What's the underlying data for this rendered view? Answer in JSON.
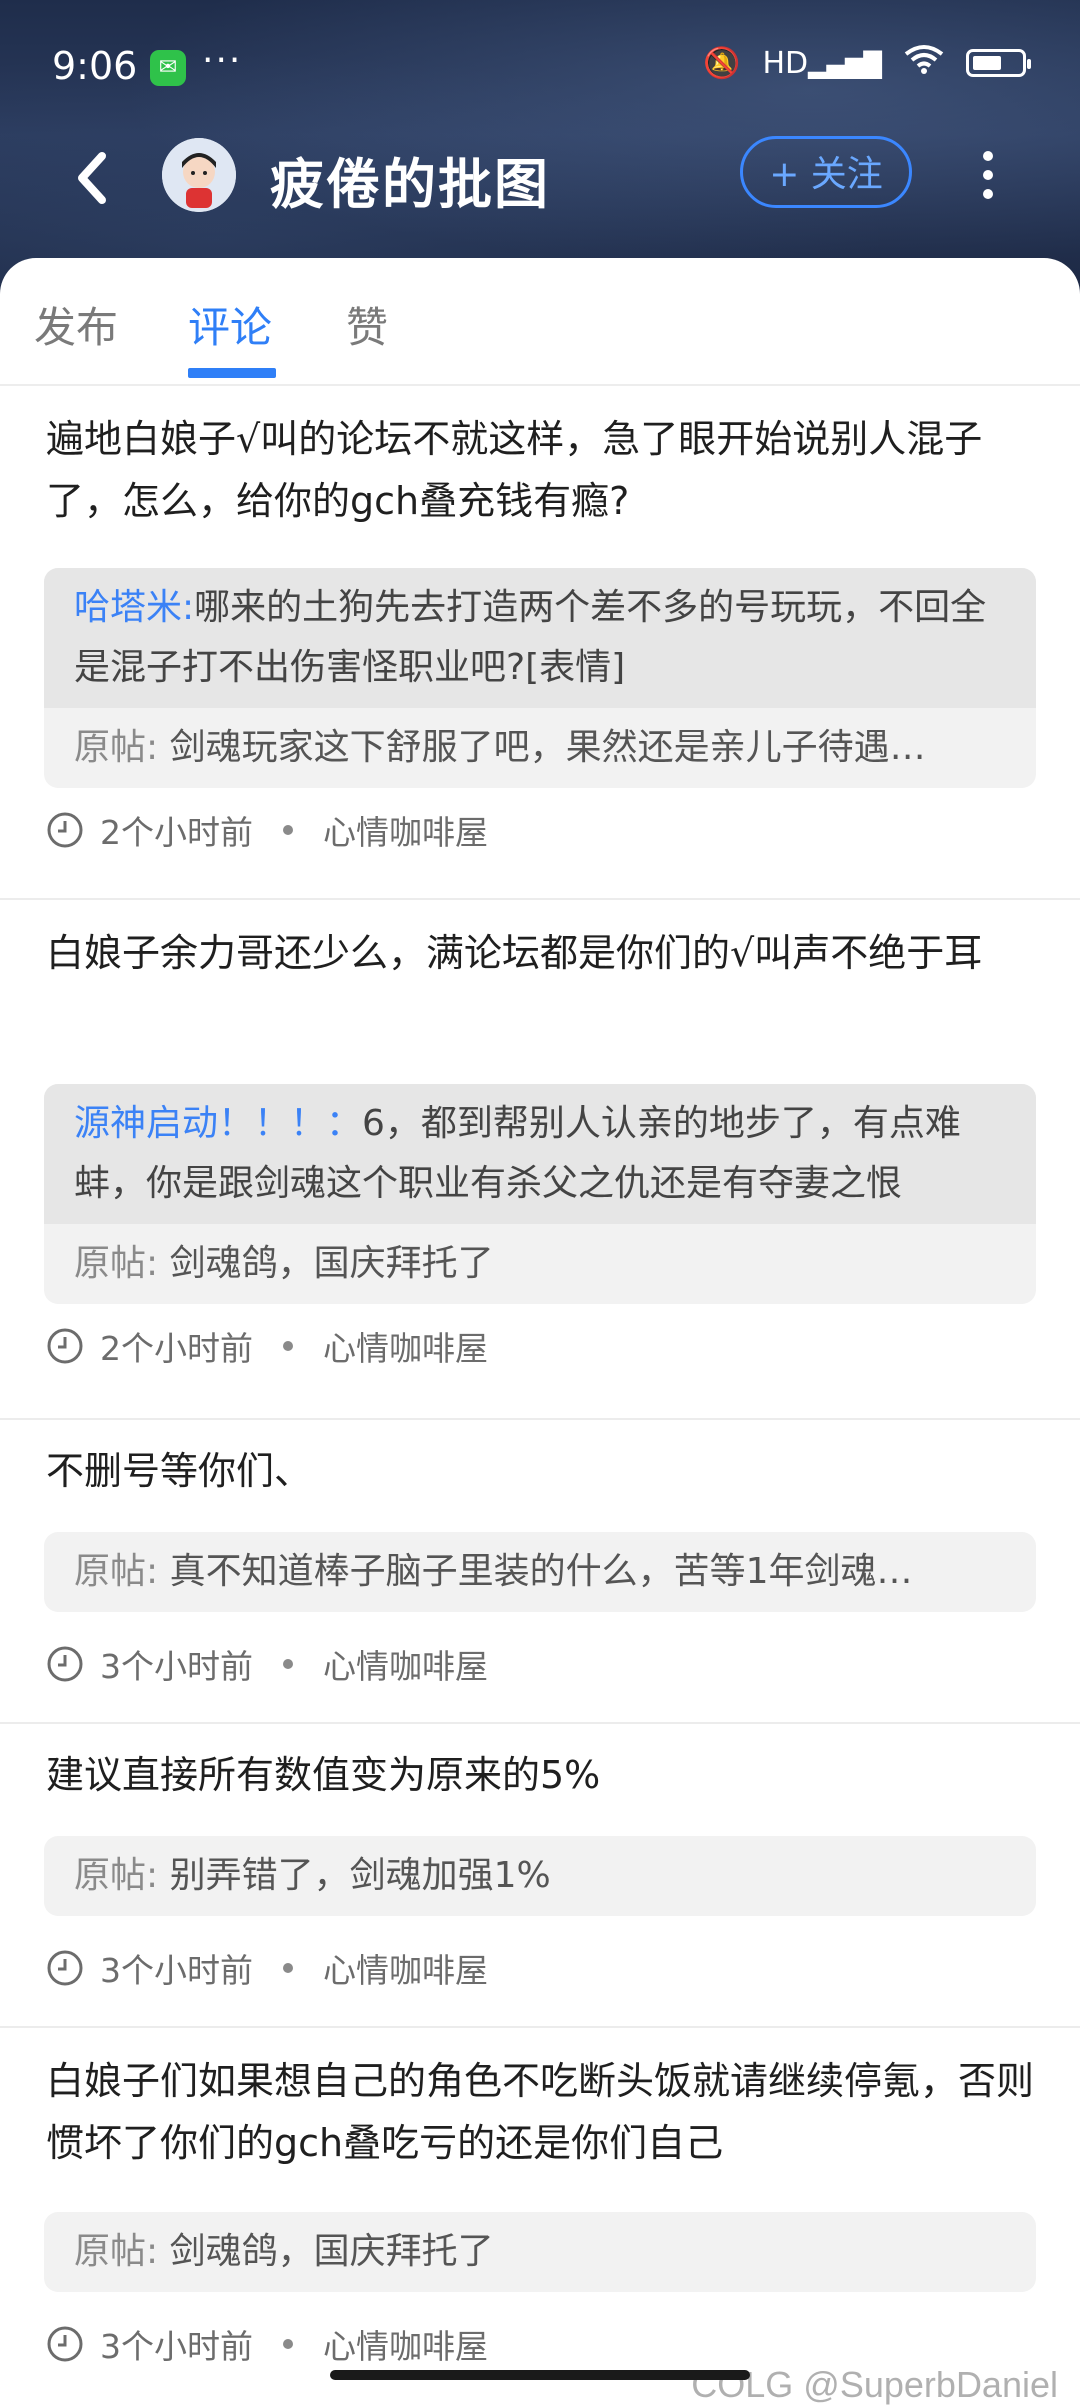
{
  "status_bar": {
    "time": "9:06",
    "more": "···",
    "hd": "HD"
  },
  "header": {
    "title": "疲倦的批图",
    "follow_label": "+ 关注"
  },
  "tabs": [
    {
      "label": "发布",
      "active": false
    },
    {
      "label": "评论",
      "active": true
    },
    {
      "label": "赞",
      "active": false
    }
  ],
  "comments": [
    {
      "text": "遍地白娘子√叫的论坛不就这样，急了眼开始说别人混子了，怎么，给你的gch叠充钱有瘾?",
      "reply_name": "哈塔米:",
      "reply_text": "哪来的土狗先去打造两个差不多的号玩玩，不回全是混子打不出伤害怪职业吧?[表情]",
      "orig_label": "原帖:",
      "orig_text": "剑魂玩家这下舒服了吧，果然还是亲儿子待遇…",
      "time": "2个小时前",
      "forum": "心情咖啡屋"
    },
    {
      "text": "白娘子余力哥还少么，满论坛都是你们的√叫声不绝于耳",
      "reply_name": "源神启动！！！：",
      "reply_text": "6，都到帮别人认亲的地步了，有点难蚌，你是跟剑魂这个职业有杀父之仇还是有夺妻之恨",
      "orig_label": "原帖:",
      "orig_text": "剑魂鸽，国庆拜托了",
      "time": "2个小时前",
      "forum": "心情咖啡屋"
    },
    {
      "text": "不删号等你们、",
      "orig_label": "原帖:",
      "orig_text": "真不知道棒子脑子里装的什么，苦等1年剑魂…",
      "time": "3个小时前",
      "forum": "心情咖啡屋"
    },
    {
      "text": "建议直接所有数值变为原来的5%",
      "orig_label": "原帖:",
      "orig_text": "别弄错了，剑魂加强1%",
      "time": "3个小时前",
      "forum": "心情咖啡屋"
    },
    {
      "text": "白娘子们如果想自己的角色不吃断头饭就请继续停氪，否则惯坏了你们的gch叠吃亏的还是你们自己",
      "orig_label": "原帖:",
      "orig_text": "剑魂鸽，国庆拜托了",
      "time": "3个小时前",
      "forum": "心情咖啡屋"
    }
  ],
  "watermark": "COLG @SuperbDaniel"
}
